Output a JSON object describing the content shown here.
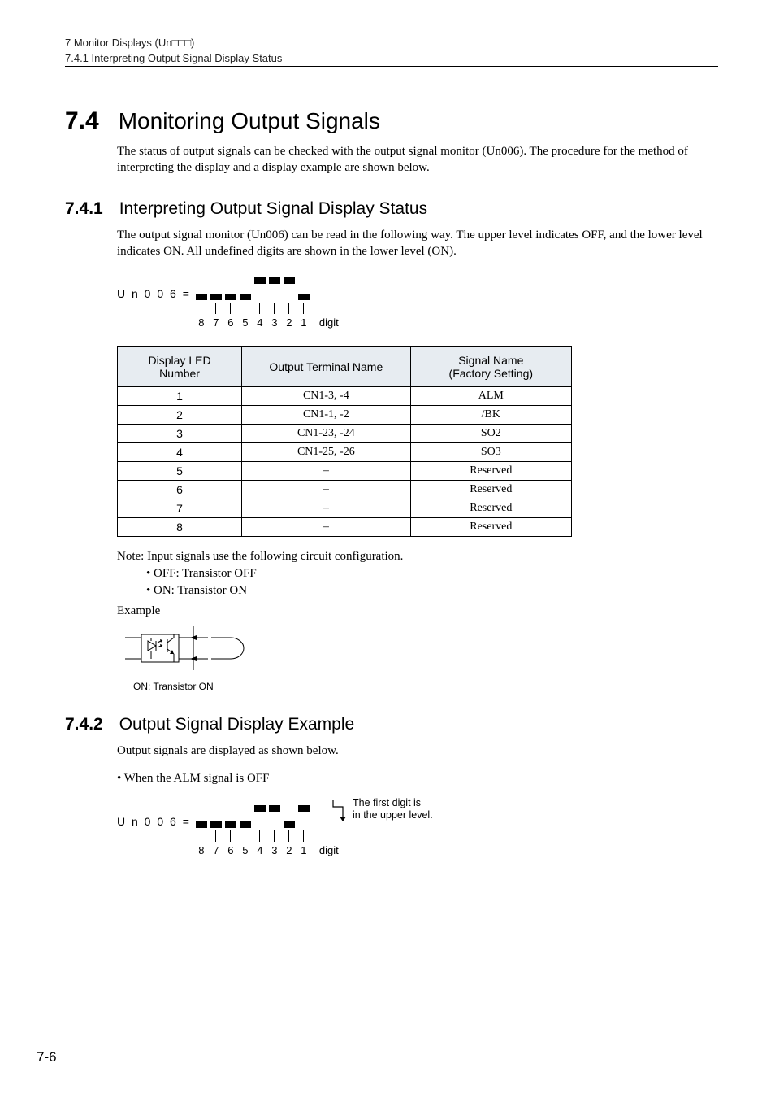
{
  "header": {
    "chapter": "7  Monitor Displays (Un□□□)",
    "subsection": "7.4.1  Interpreting Output Signal Display Status"
  },
  "sec": {
    "num": "7.4",
    "title": "Monitoring Output Signals",
    "intro": "The status of output signals can be checked with the output signal monitor (Un006). The procedure for the method of interpreting the display and a display example are shown below."
  },
  "sub1": {
    "num": "7.4.1",
    "title": "Interpreting Output Signal Display Status",
    "para": "The output signal monitor (Un006) can be read in the following way. The upper level indicates OFF, and the lower level indicates ON. All undefined digits are shown in the lower level (ON)."
  },
  "diagram1": {
    "prefix": "U n 0 0 6 =",
    "digits": [
      "8",
      "7",
      "6",
      "5",
      "4",
      "3",
      "2",
      "1"
    ],
    "digit_word": "digit",
    "segments": [
      {
        "top": false,
        "bot": true
      },
      {
        "top": false,
        "bot": true
      },
      {
        "top": false,
        "bot": true
      },
      {
        "top": false,
        "bot": true
      },
      {
        "top": true,
        "bot": false
      },
      {
        "top": true,
        "bot": false
      },
      {
        "top": true,
        "bot": false
      },
      {
        "top": false,
        "bot": true
      }
    ]
  },
  "table": {
    "headers": [
      "Display LED\nNumber",
      "Output Terminal Name",
      "Signal Name\n(Factory Setting)"
    ],
    "rows": [
      {
        "n": "1",
        "t": "CN1-3, -4",
        "s": "ALM"
      },
      {
        "n": "2",
        "t": "CN1-1, -2",
        "s": "/BK"
      },
      {
        "n": "3",
        "t": "CN1-23, -24",
        "s": "SO2"
      },
      {
        "n": "4",
        "t": "CN1-25, -26",
        "s": "SO3"
      },
      {
        "n": "5",
        "t": "–",
        "s": "Reserved"
      },
      {
        "n": "6",
        "t": "–",
        "s": "Reserved"
      },
      {
        "n": "7",
        "t": "–",
        "s": "Reserved"
      },
      {
        "n": "8",
        "t": "–",
        "s": "Reserved"
      }
    ]
  },
  "note": {
    "line": "Note: Input signals use the following circuit configuration.",
    "b1": "• OFF: Transistor OFF",
    "b2": "• ON: Transistor ON"
  },
  "example_label": "Example",
  "circuit_caption": "ON: Transistor ON",
  "sub2": {
    "num": "7.4.2",
    "title": "Output Signal Display Example",
    "para": "Output signals are displayed as shown below.",
    "bullet": "• When the ALM signal is OFF"
  },
  "diagram2": {
    "prefix": "U n 0 0 6 =",
    "digits": [
      "8",
      "7",
      "6",
      "5",
      "4",
      "3",
      "2",
      "1"
    ],
    "digit_word": "digit",
    "segments": [
      {
        "top": false,
        "bot": true
      },
      {
        "top": false,
        "bot": true
      },
      {
        "top": false,
        "bot": true
      },
      {
        "top": false,
        "bot": true
      },
      {
        "top": true,
        "bot": false
      },
      {
        "top": true,
        "bot": false
      },
      {
        "top": false,
        "bot": true
      },
      {
        "top": true,
        "bot": false
      }
    ],
    "callout1": "The first digit is",
    "callout2": "in the upper level."
  },
  "page_number": "7-6",
  "chart_data": {
    "type": "table",
    "title": "Output Signal Display LEDs",
    "columns": [
      "Display LED Number",
      "Output Terminal Name",
      "Signal Name (Factory Setting)"
    ],
    "rows": [
      [
        "1",
        "CN1-3, -4",
        "ALM"
      ],
      [
        "2",
        "CN1-1, -2",
        "/BK"
      ],
      [
        "3",
        "CN1-23, -24",
        "SO2"
      ],
      [
        "4",
        "CN1-25, -26",
        "SO3"
      ],
      [
        "5",
        "–",
        "Reserved"
      ],
      [
        "6",
        "–",
        "Reserved"
      ],
      [
        "7",
        "–",
        "Reserved"
      ],
      [
        "8",
        "–",
        "Reserved"
      ]
    ]
  }
}
